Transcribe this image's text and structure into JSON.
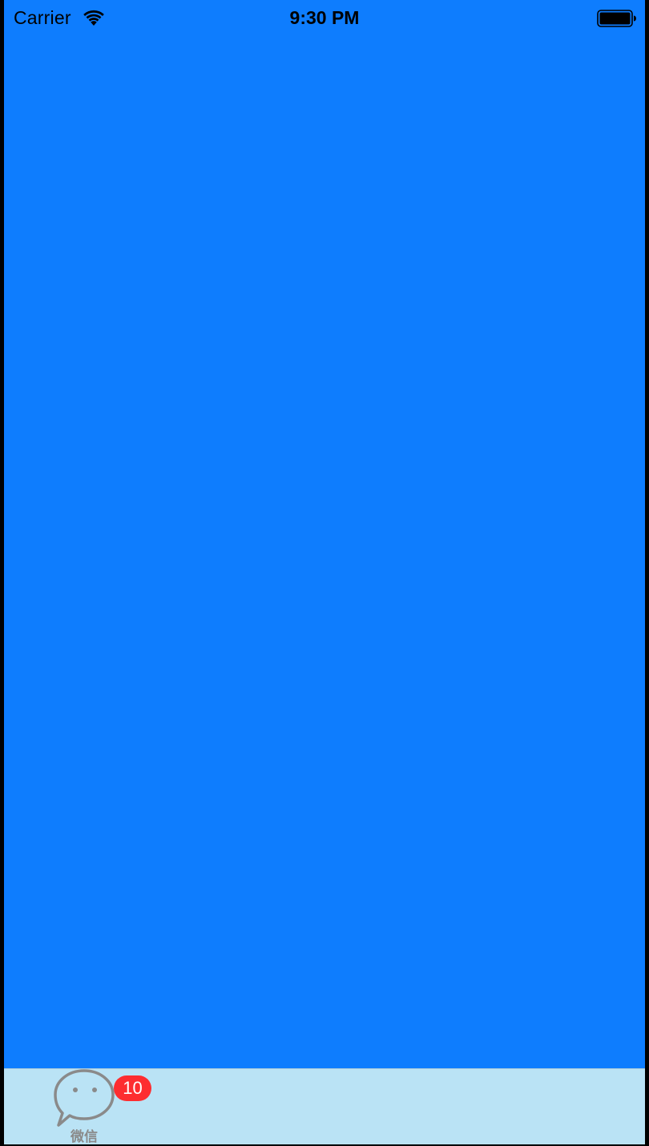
{
  "status_bar": {
    "carrier": "Carrier",
    "time": "9:30 PM",
    "wifi_icon": "wifi-icon",
    "battery_icon": "battery-icon"
  },
  "colors": {
    "content_background": "#0e7dfe",
    "tab_bar_background": "#bae3f5",
    "badge_background": "#fd2d30",
    "tab_icon_color": "#8a8a8a"
  },
  "tab_bar": {
    "items": [
      {
        "label": "微信",
        "icon": "chat-bubble-icon",
        "badge": "10"
      }
    ]
  }
}
